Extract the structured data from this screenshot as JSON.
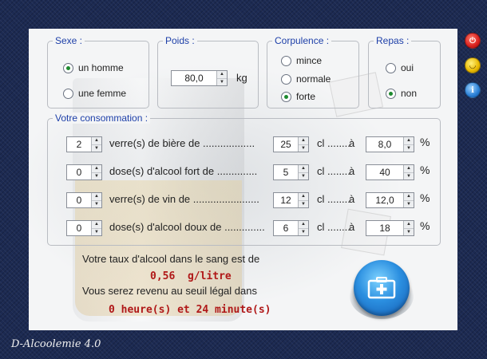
{
  "app": {
    "footer_title": "D-Alcoolemie 4.0"
  },
  "sexe": {
    "title": "Sexe :",
    "options": [
      {
        "label": "un homme",
        "selected": true
      },
      {
        "label": "une femme",
        "selected": false
      }
    ]
  },
  "poids": {
    "title": "Poids :",
    "value": "80,0",
    "unit": "kg"
  },
  "corpulence": {
    "title": "Corpulence :",
    "options": [
      {
        "label": "mince",
        "selected": false
      },
      {
        "label": "normale",
        "selected": false
      },
      {
        "label": "forte",
        "selected": true
      }
    ]
  },
  "repas": {
    "title": "Repas :",
    "options": [
      {
        "label": "oui",
        "selected": false
      },
      {
        "label": "non",
        "selected": true
      }
    ]
  },
  "consommation": {
    "title": "Votre consommation :",
    "rows": [
      {
        "qty": "2",
        "label": "verre(s) de bière de ..................",
        "cl": "25",
        "degree": "8,0"
      },
      {
        "qty": "0",
        "label": "dose(s) d'alcool fort de ..............",
        "cl": "5",
        "degree": "40"
      },
      {
        "qty": "0",
        "label": "verre(s) de vin de .......................",
        "cl": "12",
        "degree": "12,0"
      },
      {
        "qty": "0",
        "label": "dose(s) d'alcool doux de ..............",
        "cl": "6",
        "degree": "18"
      }
    ],
    "cl_label": "cl ........",
    "a_label": "à",
    "percent_label": "%"
  },
  "result": {
    "intro": "Votre taux d'alcool dans le sang est de",
    "rate": "0,56  g/litre",
    "return_text": "Vous serez revenu au seuil légal dans",
    "duration": "0 heure(s) et 24 minute(s)"
  },
  "side_buttons": {
    "close_color": "#d8201e",
    "minimize_color": "#e8b800",
    "info_color": "#2a7fd6"
  }
}
